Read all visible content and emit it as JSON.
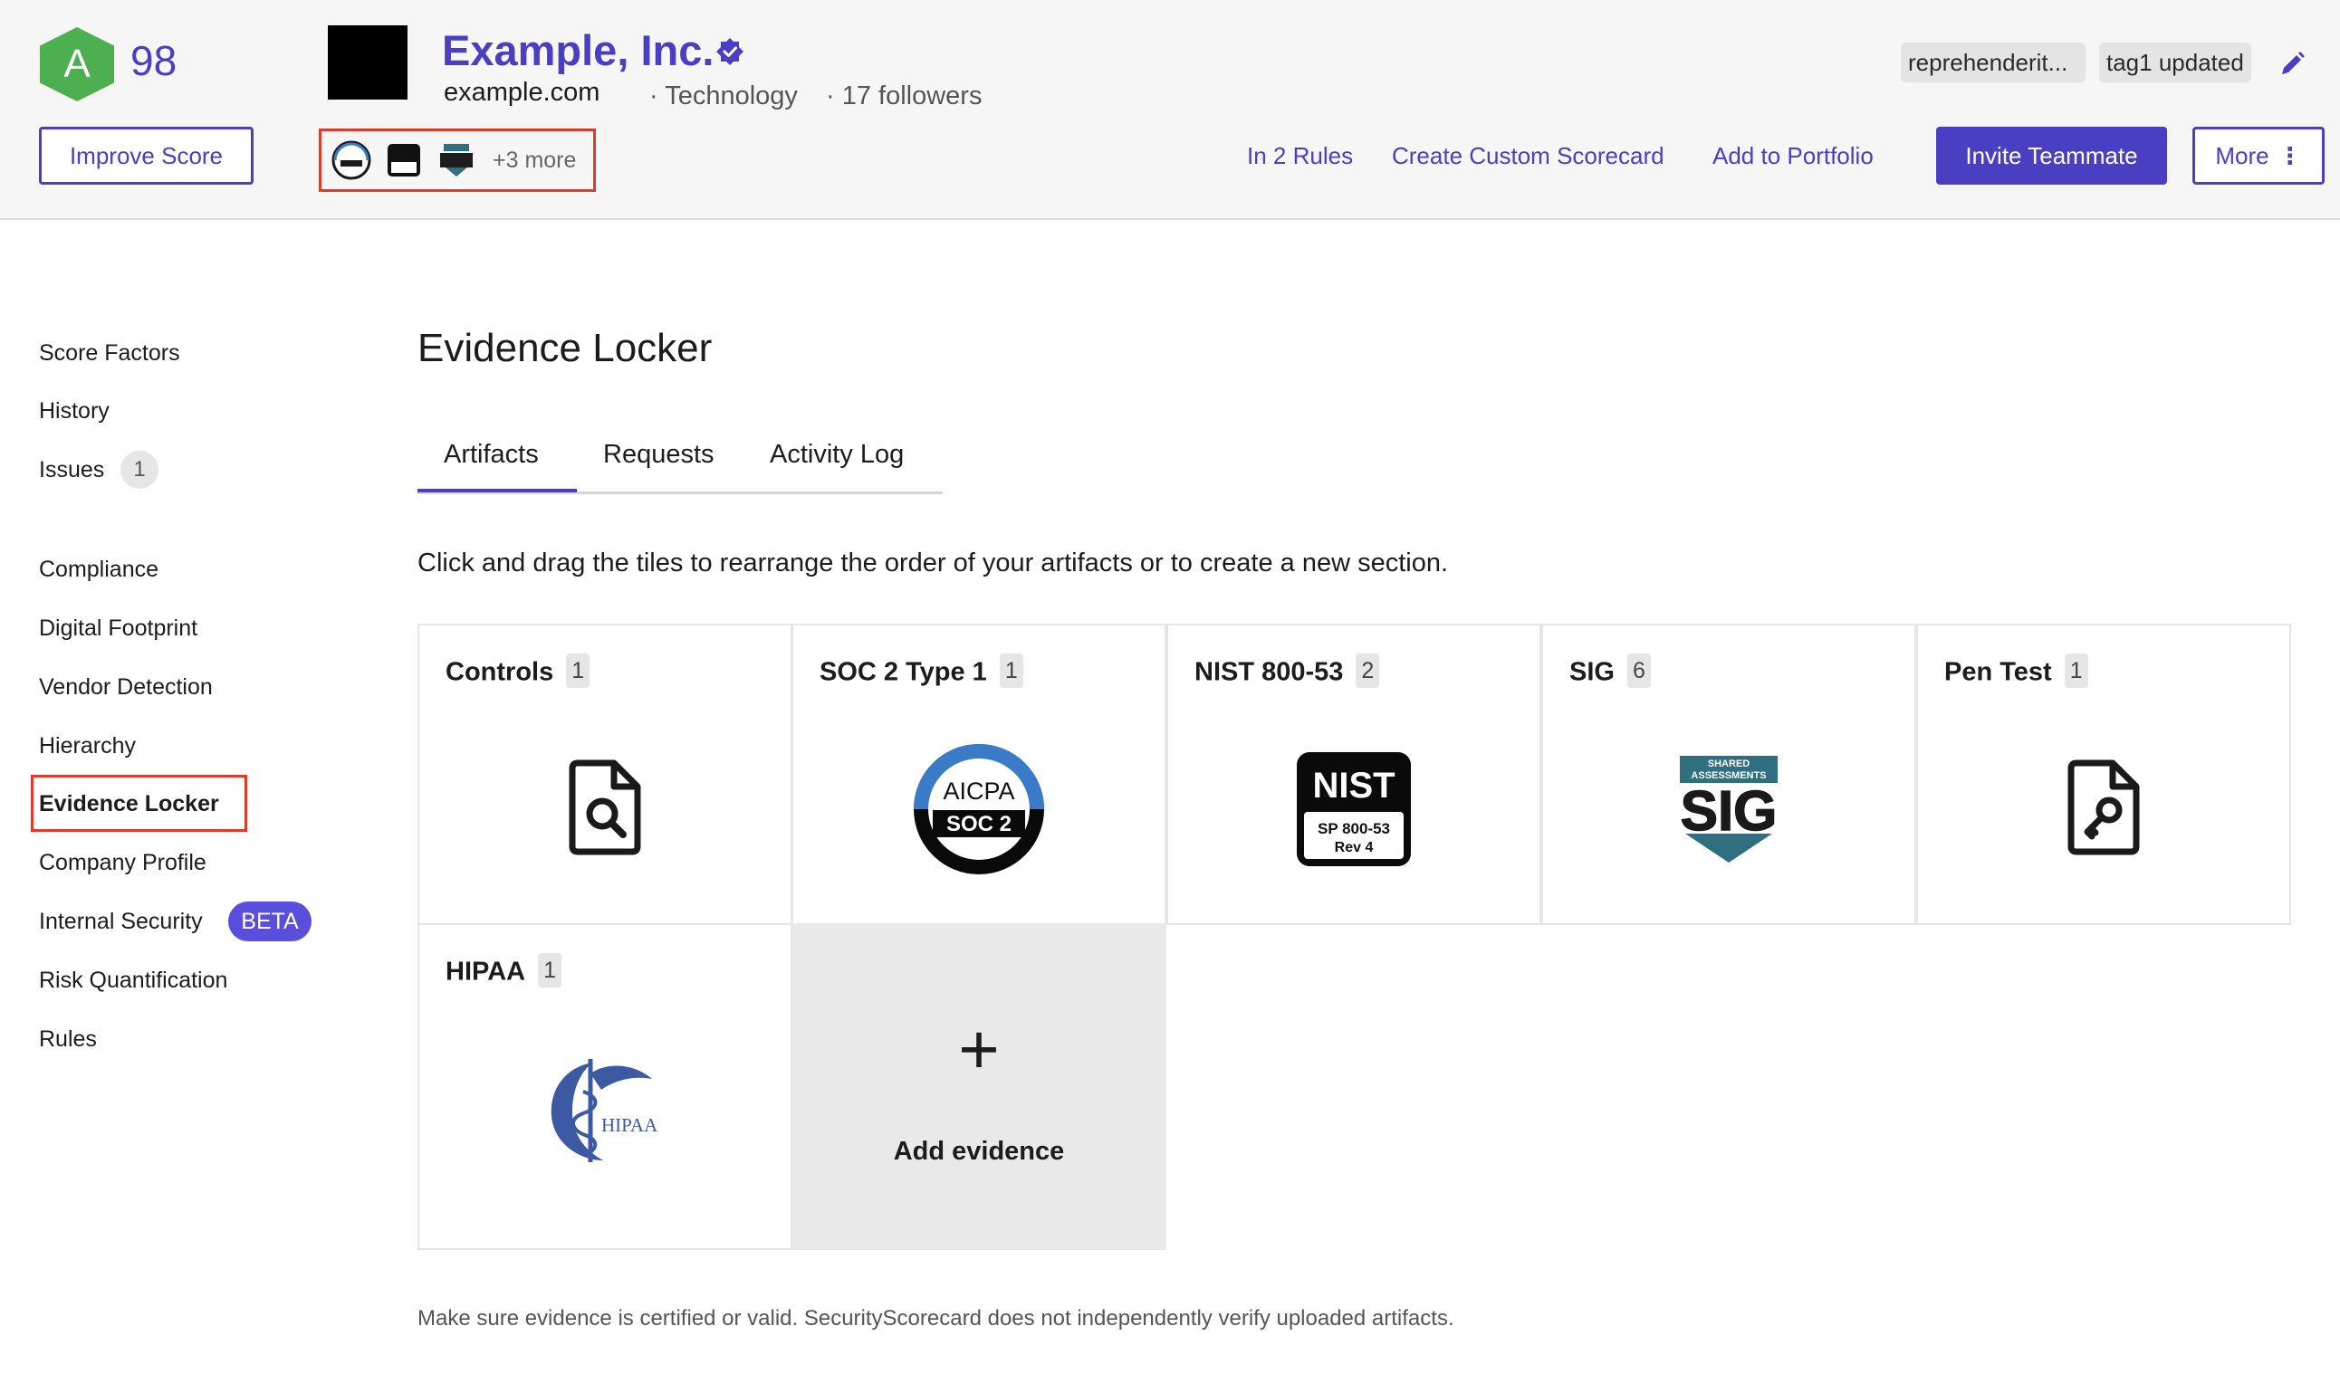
{
  "header": {
    "grade": "A",
    "score": "98",
    "improve_label": "Improve Score",
    "company_name": "Example, Inc.",
    "domain": "example.com",
    "industry": "· Technology",
    "followers": "· 17 followers",
    "badges_more": "+3 more",
    "tags": [
      "reprehenderit...",
      "tag1 updated"
    ],
    "links": {
      "rules": "In 2 Rules",
      "scorecard": "Create Custom Scorecard",
      "portfolio": "Add to Portfolio"
    },
    "invite_label": "Invite Teammate",
    "more_label": "More"
  },
  "sidebar": {
    "group1": [
      {
        "label": "Score Factors"
      },
      {
        "label": "History"
      },
      {
        "label": "Issues",
        "count": "1"
      }
    ],
    "group2": [
      {
        "label": "Compliance"
      },
      {
        "label": "Digital Footprint"
      },
      {
        "label": "Vendor Detection"
      },
      {
        "label": "Hierarchy"
      },
      {
        "label": "Evidence Locker",
        "active": true
      },
      {
        "label": "Company Profile"
      },
      {
        "label": "Internal Security",
        "badge": "BETA"
      },
      {
        "label": "Risk Quantification"
      },
      {
        "label": "Rules"
      }
    ]
  },
  "main": {
    "title": "Evidence Locker",
    "tabs": [
      {
        "label": "Artifacts",
        "active": true
      },
      {
        "label": "Requests"
      },
      {
        "label": "Activity Log"
      }
    ],
    "instructions": "Click and drag the tiles to rearrange the order of your artifacts or to create a new section.",
    "tiles": [
      {
        "title": "Controls",
        "count": "1",
        "icon": "file-search-icon"
      },
      {
        "title": "SOC 2 Type 1",
        "count": "1",
        "icon": "aicpa-soc2-logo"
      },
      {
        "title": "NIST 800-53",
        "count": "2",
        "icon": "nist-logo"
      },
      {
        "title": "SIG",
        "count": "6",
        "icon": "sig-logo"
      },
      {
        "title": "Pen Test",
        "count": "1",
        "icon": "file-key-icon"
      },
      {
        "title": "HIPAA",
        "count": "1",
        "icon": "hipaa-logo"
      }
    ],
    "add_evidence_label": "Add evidence",
    "disclaimer": "Make sure evidence is certified or valid. SecurityScorecard does not independently verify uploaded artifacts."
  },
  "logos": {
    "aicpa_text": "AICPA",
    "soc2_text": "SOC 2",
    "nist_text": "NIST",
    "nist_sub1": "SP 800-53",
    "nist_sub2": "Rev 4",
    "sig_top1": "SHARED",
    "sig_top2": "ASSESSMENTS",
    "sig_text": "SIG",
    "hipaa_text": "HIPAA"
  },
  "colors": {
    "brand": "#4a3fc2",
    "grade_green": "#4caf50",
    "highlight_red": "#e03a2a"
  }
}
